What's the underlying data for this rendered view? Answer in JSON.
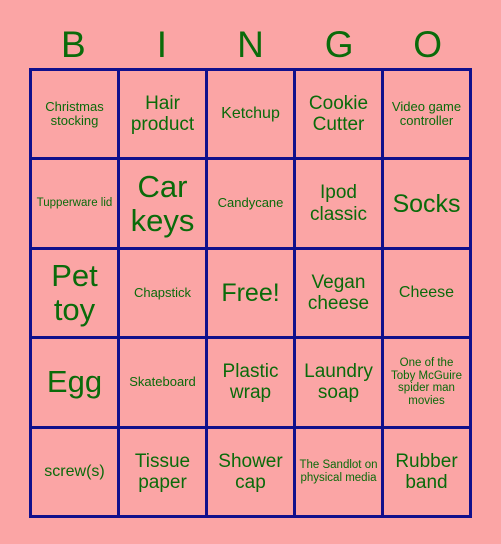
{
  "card": {
    "title_letters": [
      "B",
      "I",
      "N",
      "G",
      "O"
    ],
    "colors": {
      "background": "#fba5a5",
      "cell_background": "#fba5a5",
      "grid_line": "#10108c",
      "text": "#0a6b0a"
    },
    "rows": [
      [
        {
          "label": "Christmas stocking",
          "size": "sz-s",
          "marked": false
        },
        {
          "label": "Hair product",
          "size": "sz-l",
          "marked": false
        },
        {
          "label": "Ketchup",
          "size": "sz-m",
          "marked": false
        },
        {
          "label": "Cookie Cutter",
          "size": "sz-l",
          "marked": false
        },
        {
          "label": "Video game controller",
          "size": "sz-s",
          "marked": false
        }
      ],
      [
        {
          "label": "Tupperware lid",
          "size": "sz-xs",
          "marked": false
        },
        {
          "label": "Car keys",
          "size": "sz-xxl",
          "marked": false
        },
        {
          "label": "Candycane",
          "size": "sz-s",
          "marked": false
        },
        {
          "label": "Ipod classic",
          "size": "sz-l",
          "marked": false
        },
        {
          "label": "Socks",
          "size": "sz-xl",
          "marked": false
        }
      ],
      [
        {
          "label": "Pet toy",
          "size": "sz-xxl",
          "marked": false
        },
        {
          "label": "Chapstick",
          "size": "sz-s",
          "marked": false
        },
        {
          "label": "Free!",
          "size": "sz-xl",
          "marked": true
        },
        {
          "label": "Vegan cheese",
          "size": "sz-l",
          "marked": false
        },
        {
          "label": "Cheese",
          "size": "sz-m",
          "marked": false
        }
      ],
      [
        {
          "label": "Egg",
          "size": "sz-xxl",
          "marked": false
        },
        {
          "label": "Skateboard",
          "size": "sz-s",
          "marked": false
        },
        {
          "label": "Plastic wrap",
          "size": "sz-l",
          "marked": false
        },
        {
          "label": "Laundry soap",
          "size": "sz-l",
          "marked": false
        },
        {
          "label": "One of the Toby McGuire spider man movies",
          "size": "sz-xs",
          "marked": false
        }
      ],
      [
        {
          "label": "screw(s)",
          "size": "sz-m",
          "marked": false
        },
        {
          "label": "Tissue paper",
          "size": "sz-l",
          "marked": false
        },
        {
          "label": "Shower cap",
          "size": "sz-l",
          "marked": false
        },
        {
          "label": "The Sandlot on physical media",
          "size": "sz-xs",
          "marked": false
        },
        {
          "label": "Rubber band",
          "size": "sz-l",
          "marked": false
        }
      ]
    ]
  }
}
